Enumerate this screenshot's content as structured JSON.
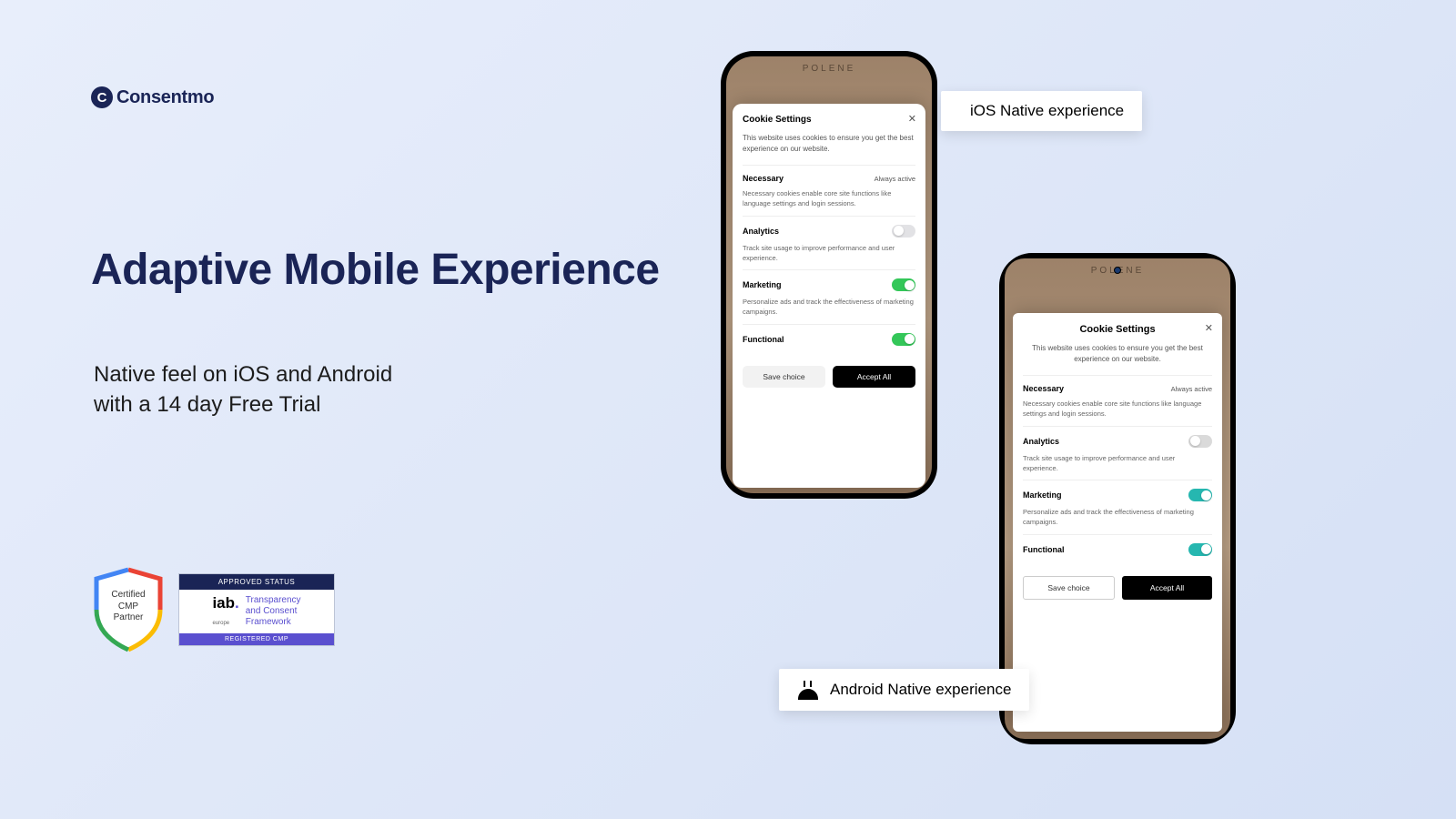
{
  "brand": {
    "name": "Consentmo",
    "mark": "C"
  },
  "hero": {
    "headline": "Adaptive Mobile Experience",
    "subhead_l1": "Native feel on iOS and Android",
    "subhead_l2": "with a 14 day Free Trial"
  },
  "badges": {
    "shield_l1": "Certified",
    "shield_l2": "CMP",
    "shield_l3": "Partner",
    "iab_top": "APPROVED STATUS",
    "iab_logo": "iab",
    "iab_sub": "europe",
    "iab_right_l1": "Transparency",
    "iab_right_l2": "and Consent",
    "iab_right_l3": "Framework",
    "iab_bottom": "REGISTERED CMP"
  },
  "tags": {
    "ios": "iOS Native experience",
    "android": "Android Native experience"
  },
  "phone_brand": "POLENE",
  "cookie": {
    "title": "Cookie Settings",
    "desc": "This website uses cookies to ensure you get the best experience on our website.",
    "save": "Save choice",
    "accept": "Accept All",
    "cats": [
      {
        "name": "Necessary",
        "always": "Always active",
        "desc": "Necessary cookies enable core site functions like language settings and login sessions."
      },
      {
        "name": "Analytics",
        "desc": "Track site usage to improve performance and user experience."
      },
      {
        "name": "Marketing",
        "desc": "Personalize ads and track the effectiveness of marketing campaigns."
      },
      {
        "name": "Functional",
        "desc": ""
      }
    ]
  }
}
